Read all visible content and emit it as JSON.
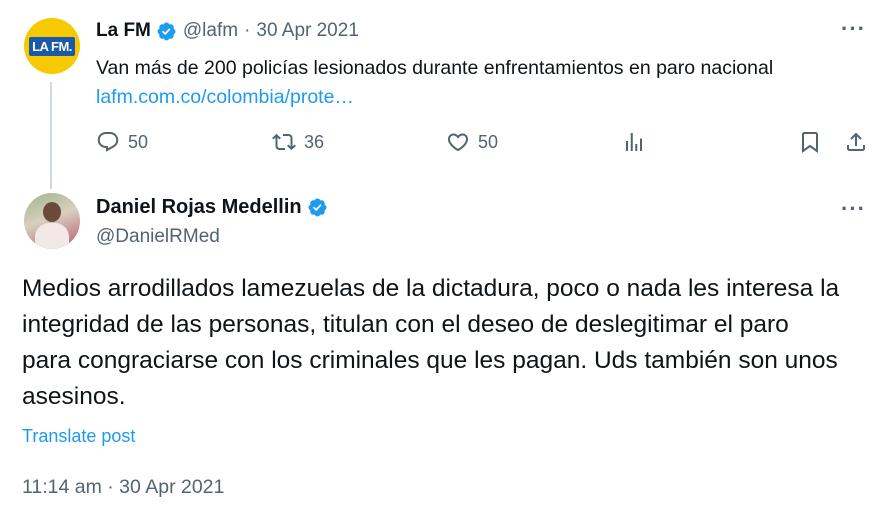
{
  "parent_tweet": {
    "avatar_logo_text": "LA FM.",
    "name": "La FM",
    "handle": "@lafm",
    "separator": "·",
    "date": "30 Apr 2021",
    "text": "Van más de 200 policías lesionados durante enfrentamientos en paro nacional",
    "link": "lafm.com.co/colombia/prote…",
    "actions": {
      "replies": "50",
      "retweets": "36",
      "likes": "50"
    }
  },
  "main_tweet": {
    "name": "Daniel Rojas Medellin",
    "handle": "@DanielRMed",
    "text": "Medios arrodillados lamezuelas de la dictadura, poco o nada les interesa la integridad de las personas, titulan con el deseo de deslegitimar el paro para congraciarse con los criminales que les pagan. Uds también son unos asesinos.",
    "translate_label": "Translate post",
    "timestamp": "11:14 am · 30 Apr 2021"
  },
  "more_label": "···",
  "colors": {
    "accent": "#1d9bf0",
    "muted": "#536471",
    "text": "#0f1419",
    "thread_line": "#cfd9de"
  }
}
